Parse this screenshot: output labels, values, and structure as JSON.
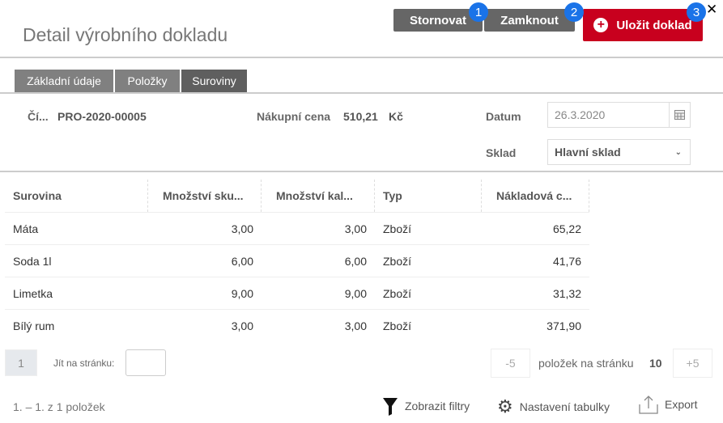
{
  "header": {
    "title": "Detail výrobního dokladu",
    "cancel": "Stornovat",
    "lock": "Zamknout",
    "save": "Uložit doklad",
    "badges": [
      "1",
      "2",
      "3"
    ],
    "close": "✕"
  },
  "tabs": [
    "Základní údaje",
    "Položky",
    "Suroviny"
  ],
  "form": {
    "number_label": "Čí...",
    "number": "PRO-2020-00005",
    "price_label": "Nákupní cena",
    "price": "510,21",
    "currency": "Kč",
    "date_label": "Datum",
    "date": "26.3.2020",
    "store_label": "Sklad",
    "store": "Hlavní sklad"
  },
  "table": {
    "columns": [
      "Surovina",
      "Množství sku...",
      "Množství kal...",
      "Typ",
      "Nákladová c..."
    ],
    "rows": [
      [
        "Máta",
        "3,00",
        "3,00",
        "Zboží",
        "65,22"
      ],
      [
        "Soda 1l",
        "6,00",
        "6,00",
        "Zboží",
        "41,76"
      ],
      [
        "Limetka",
        "9,00",
        "9,00",
        "Zboží",
        "31,32"
      ],
      [
        "Bílý rum",
        "3,00",
        "3,00",
        "Zboží",
        "371,90"
      ]
    ]
  },
  "pager": {
    "page": "1",
    "goto_label": "Jít na stránku:",
    "minus": "-5",
    "per_page_label": "položek na stránku",
    "per_page": "10",
    "plus": "+5",
    "summary": "1. – 1. z 1 položek"
  },
  "actions": {
    "filters": "Zobrazit filtry",
    "settings": "Nastavení tabulky",
    "export": "Export"
  }
}
